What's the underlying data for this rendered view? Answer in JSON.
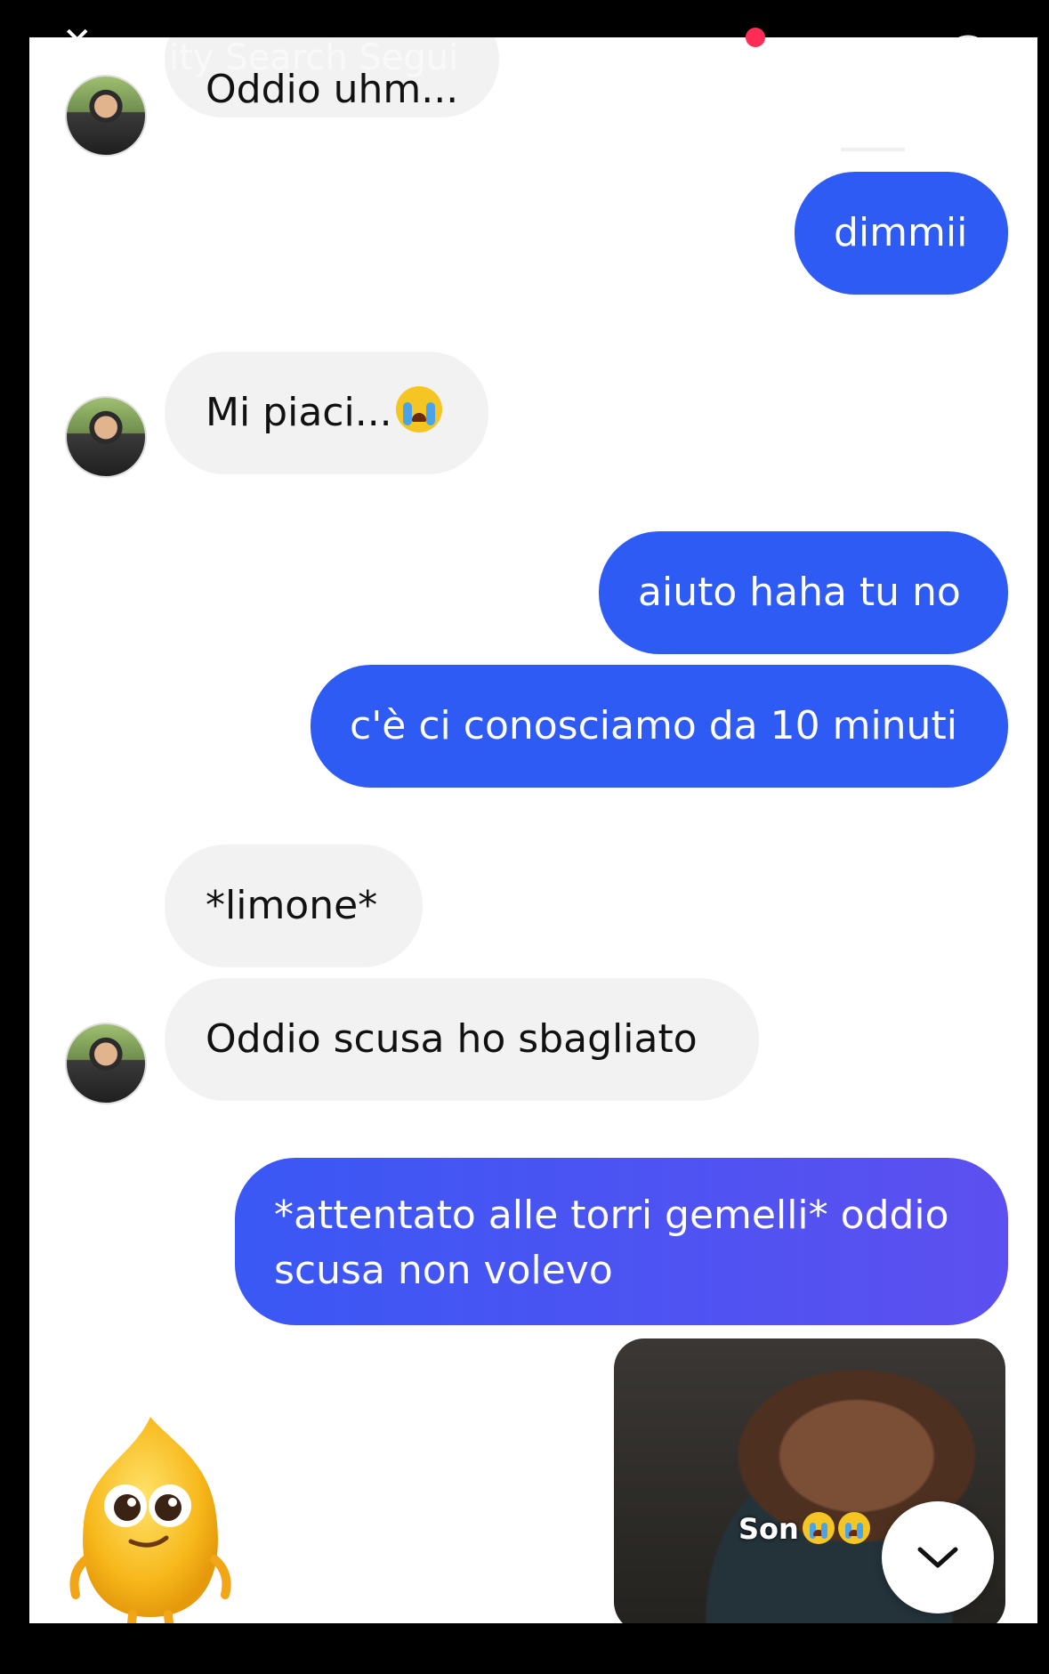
{
  "overlay": {
    "title_text": "ity Search Segui"
  },
  "messages": [
    {
      "side": "in",
      "text": "Oddio uhm..."
    },
    {
      "side": "out",
      "text": "dimmii"
    },
    {
      "side": "in",
      "text": "Mi piaci...",
      "emoji": "loudly-crying-face"
    },
    {
      "side": "out",
      "text": "aiuto haha tu no"
    },
    {
      "side": "out",
      "text": "c'è ci conosciamo da 10 minuti"
    },
    {
      "side": "in",
      "text": "*limone*"
    },
    {
      "side": "in",
      "text": "Oddio scusa ho sbagliato"
    },
    {
      "side": "out",
      "text": "*attentato alle torri gemelli* oddio scusa non volevo"
    }
  ],
  "photo": {
    "caption": "Son",
    "caption_emoji": [
      "loudly-crying-face",
      "loudly-crying-face"
    ]
  },
  "colors": {
    "outgoing": "#2f5bf5",
    "incoming": "#f2f2f2",
    "background": "#ffffff",
    "live_dot": "#ff2d55"
  },
  "icons": {
    "scroll_down": "chevron-down-icon",
    "search": "search-icon",
    "close": "close-icon"
  }
}
